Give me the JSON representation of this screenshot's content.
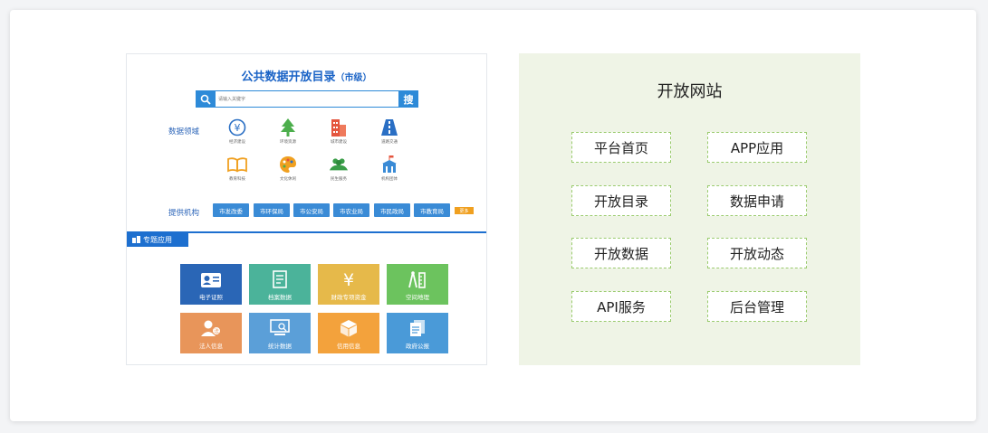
{
  "portal": {
    "title": "公共数据开放目录",
    "title_suffix": "（市级）",
    "search": {
      "placeholder": "请输入关键字",
      "button_label": "搜"
    },
    "domain_label": "数据领域",
    "domains": [
      {
        "label": "经济建设",
        "icon": "yen-icon",
        "color": "#2a6fc4"
      },
      {
        "label": "环境资源",
        "icon": "tree-icon",
        "color": "#4cae4c"
      },
      {
        "label": "城市建设",
        "icon": "building-icon",
        "color": "#e4553e"
      },
      {
        "label": "道路交通",
        "icon": "road-icon",
        "color": "#2a6fc4"
      },
      {
        "label": "教育科技",
        "icon": "book-icon",
        "color": "#f0a020"
      },
      {
        "label": "文化休闲",
        "icon": "palette-icon",
        "color": "#f0a020"
      },
      {
        "label": "民生服务",
        "icon": "people-icon",
        "color": "#3a9e48"
      },
      {
        "label": "机构团体",
        "icon": "institution-icon",
        "color": "#3a8bd6"
      }
    ],
    "org_label": "提供机构",
    "orgs": [
      "市发改委",
      "市环保局",
      "市公安局",
      "市农业局",
      "市民政局",
      "市教育局"
    ],
    "more_label": "更多",
    "topic_label": "专题应用",
    "topics": [
      {
        "label": "电子证照",
        "icon": "id-card-icon",
        "color": "#2a66b6"
      },
      {
        "label": "档案数据",
        "icon": "file-icon",
        "color": "#4bb39a"
      },
      {
        "label": "财政专项资金",
        "icon": "yen-icon",
        "color": "#e6b94a"
      },
      {
        "label": "空间地理",
        "icon": "compass-icon",
        "color": "#6cc35e"
      },
      {
        "label": "法人信息",
        "icon": "legal-person-icon",
        "color": "#e8955a"
      },
      {
        "label": "统计数据",
        "icon": "monitor-icon",
        "color": "#5b9fd8"
      },
      {
        "label": "信用信息",
        "icon": "cube-icon",
        "color": "#f3a23c"
      },
      {
        "label": "政府公报",
        "icon": "document-icon",
        "color": "#4a9ad8"
      }
    ]
  },
  "site": {
    "title": "开放网站",
    "buttons": [
      "平台首页",
      "APP应用",
      "开放目录",
      "数据申请",
      "开放数据",
      "开放动态",
      "API服务",
      "后台管理"
    ]
  }
}
